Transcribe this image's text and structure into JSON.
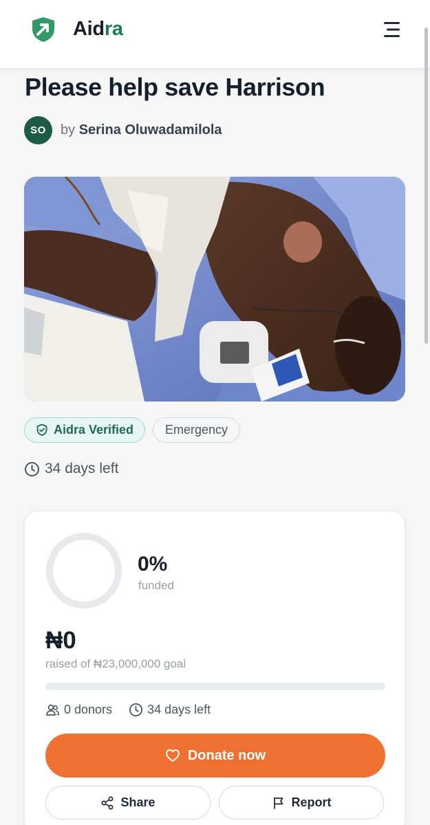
{
  "colors": {
    "brand_green": "#1f7a55",
    "avatar_bg": "#1d5a47",
    "accent_orange": "#ee7131",
    "verified_bg": "#e7f6f2",
    "text_dark": "#16202c"
  },
  "header": {
    "brand_part1": "Aid",
    "brand_part2": "ra",
    "logo_icon": "shield-arrow-icon",
    "menu_icon": "hamburger-icon"
  },
  "campaign": {
    "title": "Please help save Harrison",
    "organizer": {
      "initials": "SO",
      "by_label": "by",
      "name": "Serina Oluwadamilola"
    },
    "image_alt": "patient-photo",
    "badges": {
      "verified": "Aidra Verified",
      "category": "Emergency"
    },
    "days_left": "34 days left"
  },
  "funding": {
    "percent_value": 0,
    "percent_text": "0%",
    "percent_label": "funded",
    "raised": "₦0",
    "goal_text": "raised of ₦23,000,000 goal",
    "progress_fraction": 0,
    "donors_text": "0 donors",
    "days_left": "34 days left"
  },
  "actions": {
    "donate": "Donate now",
    "share": "Share",
    "report": "Report"
  }
}
